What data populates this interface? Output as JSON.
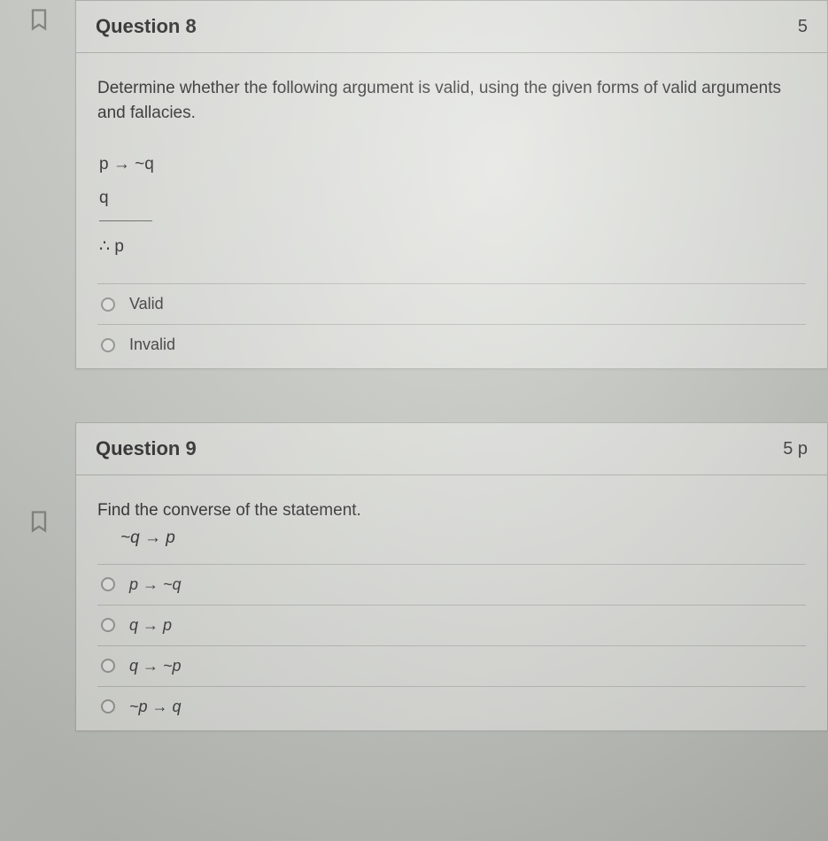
{
  "questions": [
    {
      "title": "Question 8",
      "points": "5",
      "prompt": "Determine whether the following argument is valid, using the given forms of valid arguments and fallacies.",
      "argument": {
        "premise1": "p → ~q",
        "premise2": "q",
        "conclusion": "∴ p"
      },
      "options": [
        {
          "label": "Valid"
        },
        {
          "label": "Invalid"
        }
      ]
    },
    {
      "title": "Question 9",
      "points": "5 p",
      "prompt": "Find the converse of the statement.",
      "statement": "~q → p",
      "options": [
        {
          "label": "p → ~q"
        },
        {
          "label": "q → p"
        },
        {
          "label": "q → ~p"
        },
        {
          "label": "~p → q"
        }
      ]
    }
  ]
}
